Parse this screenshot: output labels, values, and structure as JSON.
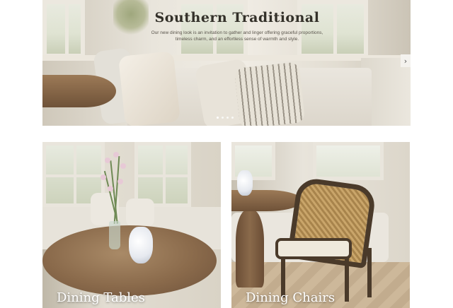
{
  "hero": {
    "title": "Southern Traditional",
    "description": "Our new dining look is an invitation to gather and linger offering graceful proportions, timeless charm, and an effortless sense of warmth and style.",
    "next_icon": "chevron-right-icon",
    "slide_count": 4,
    "active_slide": 1
  },
  "cards": [
    {
      "label": "Dining Tables"
    },
    {
      "label": "Dining Chairs"
    }
  ],
  "colors": {
    "title_text": "#333029",
    "card_label": "#ffffff",
    "page_background": "#ffffff"
  }
}
